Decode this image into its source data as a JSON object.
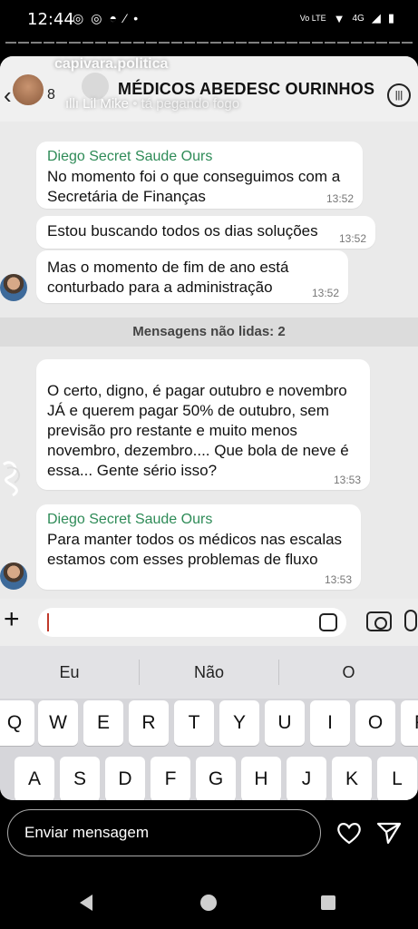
{
  "status_bar": {
    "time": "12:44",
    "left_icons": [
      "instagram-icon",
      "instagram-icon",
      "cap-icon",
      "slash-icon",
      "dot-icon"
    ],
    "right_icons": [
      "volte-icon",
      "wifi-icon",
      "4g-signal-icon",
      "battery-icon"
    ],
    "network": "4G"
  },
  "story": {
    "username": "capivara.politica",
    "music_prefix": "Lil Mike",
    "music_track": "tá pegando fogo",
    "send_placeholder": "Enviar mensagem"
  },
  "chat": {
    "back_count": "8",
    "title": "MÉDICOS ABEDESC OURINHOS",
    "messages": [
      {
        "sender": "Diego Secret Saude Ours",
        "text": "No momento foi o que conseguimos com a Secretária de Finanças",
        "time": "13:52"
      },
      {
        "sender": "",
        "text": "Estou buscando todos os dias soluções",
        "time": "13:52"
      },
      {
        "sender": "",
        "text": "Mas o momento de fim de ano está conturbado para a administração",
        "time": "13:52"
      },
      {
        "sender": "",
        "text": "O certo, digno, é pagar outubro e novembro JÁ e querem pagar 50% de outubro, sem previsão pro restante e muito menos novembro, dezembro.... Que bola de neve é essa... Gente sério isso?",
        "time": "13:53"
      },
      {
        "sender": "Diego Secret Saude Ours",
        "text": "Para manter todos os médicos nas escalas estamos com esses problemas de fluxo",
        "time": "13:53"
      }
    ],
    "unread_label": "Mensagens não lidas: 2"
  },
  "keyboard": {
    "suggestions": [
      "Eu",
      "Não",
      "O"
    ],
    "row1": [
      "Q",
      "W",
      "E",
      "R",
      "T",
      "Y",
      "U",
      "I",
      "O",
      "P"
    ],
    "row2": [
      "A",
      "S",
      "D",
      "F",
      "G",
      "H",
      "J",
      "K",
      "L"
    ]
  },
  "colors": {
    "sender": "#2e8b57",
    "bubble": "#ffffff",
    "chat_bg": "#eaeaea",
    "caret": "#c0392b"
  }
}
